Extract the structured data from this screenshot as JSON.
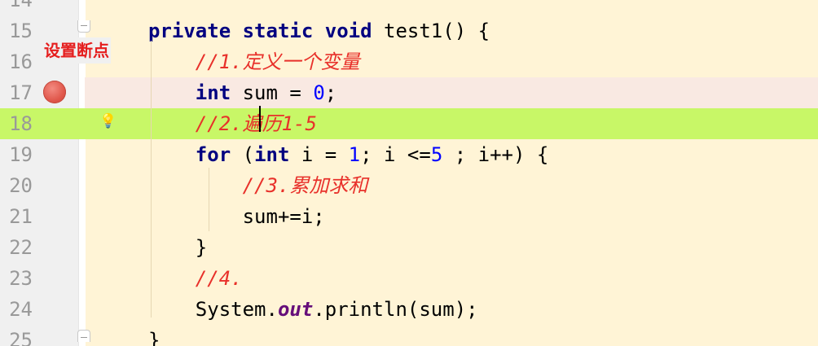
{
  "annotation": "设置断点",
  "lines": [
    {
      "number": "14",
      "tokens": []
    },
    {
      "number": "15",
      "tokens": [
        {
          "t": "private static void",
          "c": "kw"
        },
        {
          "t": " test1() {",
          "c": ""
        }
      ]
    },
    {
      "number": "16",
      "tokens": [
        {
          "t": "    //1.定义一个变量",
          "c": "cmt"
        }
      ]
    },
    {
      "number": "17",
      "tokens": [
        {
          "t": "    ",
          "c": ""
        },
        {
          "t": "int",
          "c": "kw"
        },
        {
          "t": " sum = ",
          "c": ""
        },
        {
          "t": "0",
          "c": "num"
        },
        {
          "t": ";",
          "c": ""
        }
      ]
    },
    {
      "number": "18",
      "tokens": [
        {
          "t": "    //2.遍历1-5",
          "c": "cmt"
        }
      ]
    },
    {
      "number": "19",
      "tokens": [
        {
          "t": "    ",
          "c": ""
        },
        {
          "t": "for",
          "c": "kw"
        },
        {
          "t": " (",
          "c": ""
        },
        {
          "t": "int",
          "c": "kw"
        },
        {
          "t": " i = ",
          "c": ""
        },
        {
          "t": "1",
          "c": "num"
        },
        {
          "t": "; i <=",
          "c": ""
        },
        {
          "t": "5",
          "c": "num"
        },
        {
          "t": " ; i++) {",
          "c": ""
        }
      ]
    },
    {
      "number": "20",
      "tokens": [
        {
          "t": "        //3.累加求和",
          "c": "cmt"
        }
      ]
    },
    {
      "number": "21",
      "tokens": [
        {
          "t": "        sum+=i;",
          "c": ""
        }
      ]
    },
    {
      "number": "22",
      "tokens": [
        {
          "t": "    }",
          "c": ""
        }
      ]
    },
    {
      "number": "23",
      "tokens": [
        {
          "t": "    //4.",
          "c": "cmt"
        }
      ]
    },
    {
      "number": "24",
      "tokens": [
        {
          "t": "    System.",
          "c": ""
        },
        {
          "t": "out",
          "c": "static-field"
        },
        {
          "t": ".println(sum);",
          "c": ""
        }
      ]
    },
    {
      "number": "25",
      "tokens": [
        {
          "t": "}",
          "c": ""
        }
      ]
    }
  ],
  "colors": {
    "editor_bg": "#fff4d6",
    "current_line_bg": "#c8f767",
    "breakpoint_line_bg": "#f9e9e2",
    "breakpoint": "#e0574b",
    "keyword": "#000080",
    "number": "#0000ff",
    "comment": "#e8302a",
    "annotation": "#e51e1e"
  },
  "icons": {
    "breakpoint": "breakpoint-icon",
    "intention": "lightbulb-icon"
  }
}
